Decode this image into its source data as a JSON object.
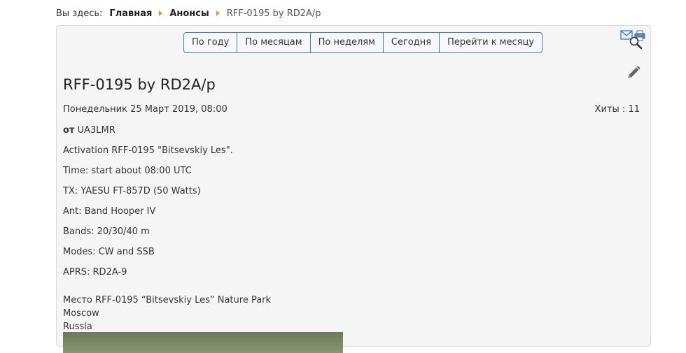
{
  "breadcrumb": {
    "here_label": "Вы здесь:",
    "items": [
      "Главная",
      "Анонсы"
    ],
    "current": "RFF-0195 by RD2A/p"
  },
  "nav": {
    "buttons": [
      "По году",
      "По месяцам",
      "По неделям",
      "Сегодня",
      "Перейти к месяцу"
    ]
  },
  "event": {
    "title": "RFF-0195 by RD2A/p",
    "date": "Понедельник 25 Март 2019, 08:00",
    "hits_label": "Хиты :",
    "hits_value": "11",
    "from_label": "от",
    "from_value": "UA3LMR",
    "lines": [
      "Activation RFF-0195 \"Bitsevskiy Les\".",
      "Time: start about 08:00 UTC",
      "TX: YAESU FT-857D (50 Watts)",
      "Ant: Band Hooper IV",
      "Bands: 20/30/40 m",
      "Modes: CW and SSB",
      "APRS: RD2A-9"
    ],
    "location": {
      "label": "Место",
      "place": "RFF-0195 “Bitsevskiy Les” Nature Park",
      "city": "Moscow",
      "country": "Russia"
    }
  },
  "colors": {
    "accent": "#4a7eb5",
    "breadcrumb_arrow": "#e8912e",
    "panel_bg": "#f5f5f5"
  },
  "icons": [
    "mail-icon",
    "print-icon",
    "search-icon",
    "edit-pencil-icon"
  ]
}
